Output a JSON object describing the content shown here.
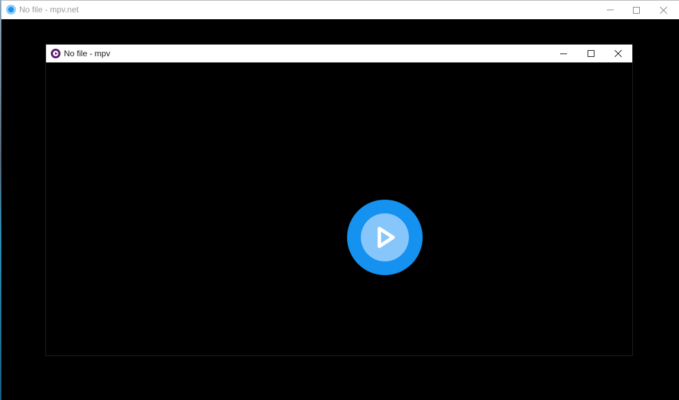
{
  "outer_window": {
    "title": "No file - mpv.net",
    "icon": "mpvnet-app-icon",
    "controls": [
      "minimize",
      "maximize",
      "close"
    ]
  },
  "inner_window": {
    "title": "No file - mpv",
    "icon": "mpv-app-icon",
    "controls": [
      "minimize",
      "maximize",
      "close"
    ]
  },
  "player": {
    "state_icon": "play-icon"
  },
  "colors": {
    "play_outer": "#1591f0",
    "play_inner": "#86c6fb",
    "mpv_icon": "#5a1a6b",
    "mpvnet_icon": "#1e90e6"
  }
}
